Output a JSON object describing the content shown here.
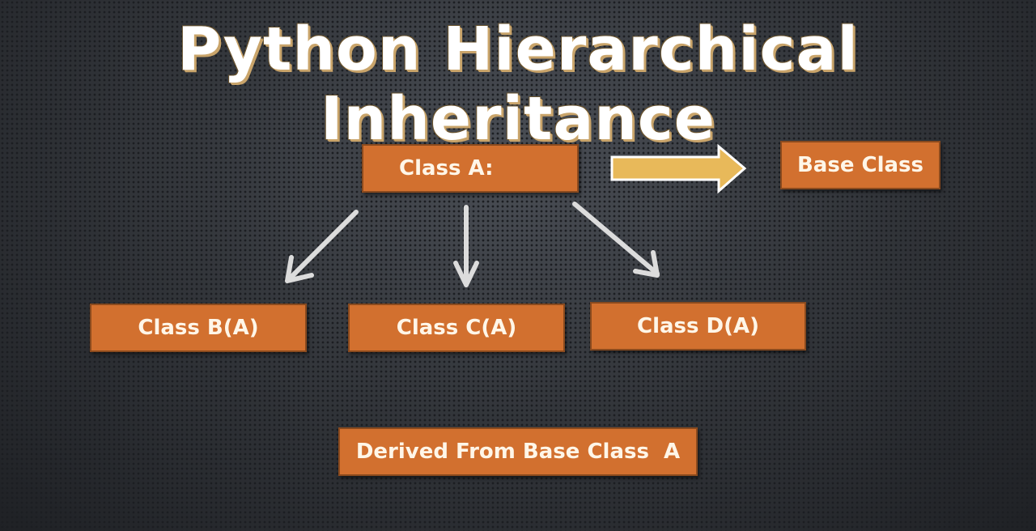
{
  "title": "Python Hierarchical Inheritance",
  "nodes": {
    "class_a": "Class A:",
    "base_class_label": "Base Class",
    "class_b": "Class B(A)",
    "class_c": "Class C(A)",
    "class_d": "Class D(A)",
    "derived_label": "Derived From Base Class  A"
  },
  "colors": {
    "box": "#d2702f",
    "arrow": "#dcdcdc",
    "highlight_arrow": "#e8b95a"
  }
}
